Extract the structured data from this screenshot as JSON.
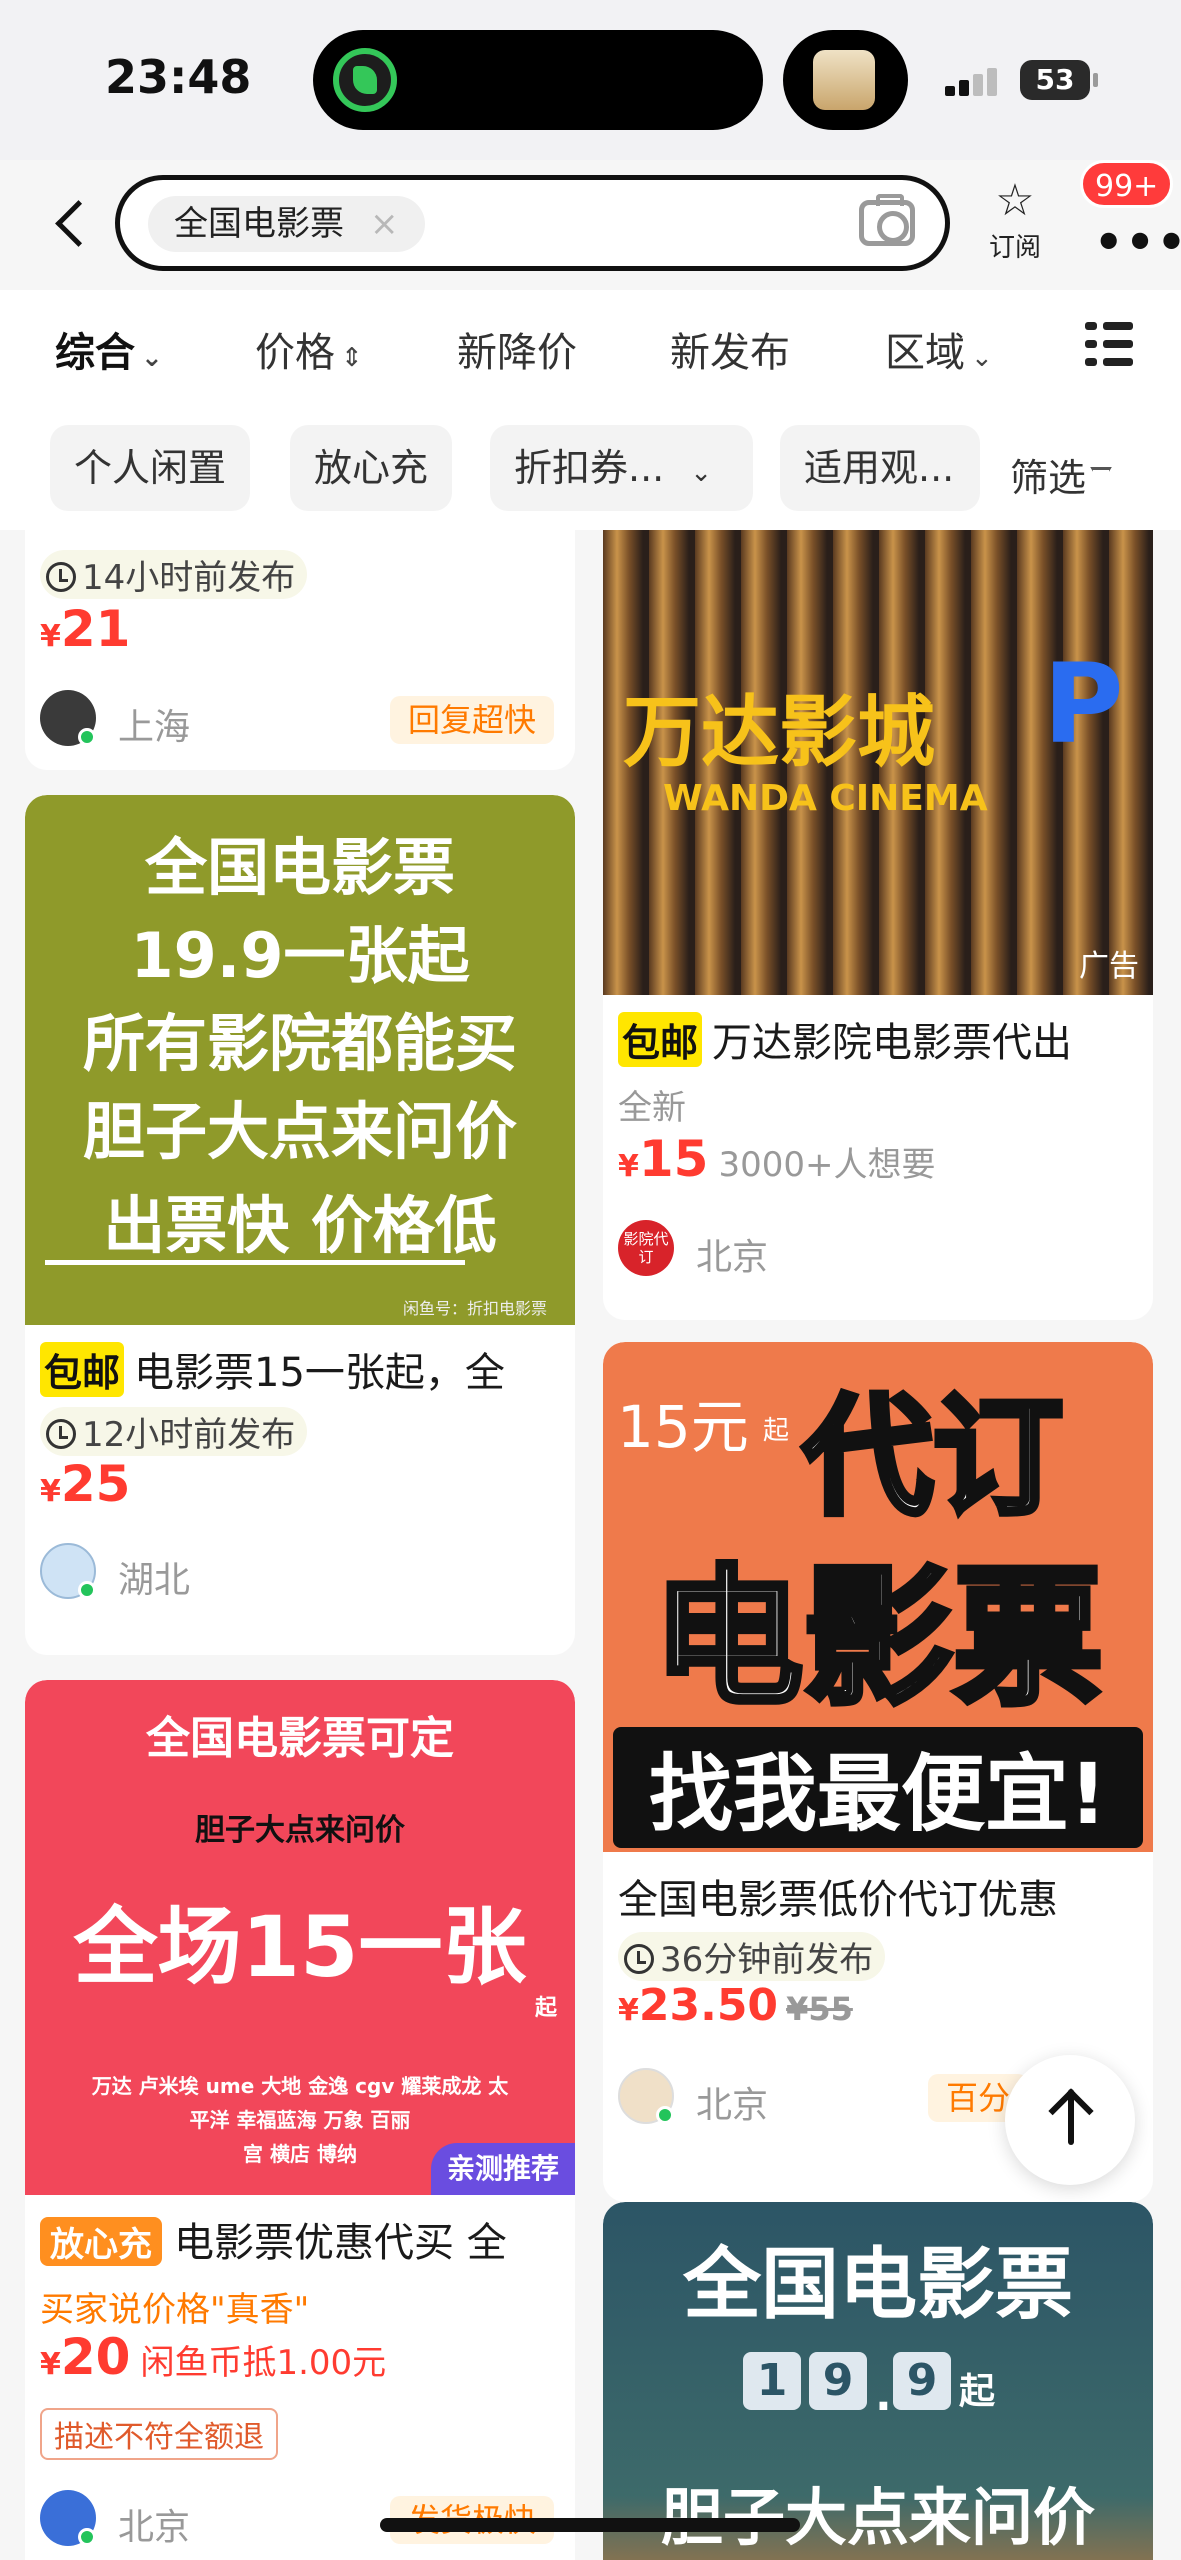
{
  "status": {
    "time": "23:48",
    "battery": "53"
  },
  "search": {
    "query": "全国电影票",
    "clear": "×"
  },
  "header": {
    "subscribe_label": "订阅",
    "badge": "99+",
    "more": "•••"
  },
  "sort_tabs": [
    {
      "label": "综合",
      "caret": "⌄"
    },
    {
      "label": "价格",
      "caret": "⇕"
    },
    {
      "label": "新降价"
    },
    {
      "label": "新发布"
    },
    {
      "label": "区域",
      "caret": "⌄"
    }
  ],
  "filters": [
    "个人闲置",
    "放心充",
    "折扣券...",
    "适用观...",
    "筛选"
  ],
  "left_column": {
    "card0": {
      "time": "14小时前发布",
      "price": "21",
      "location": "上海",
      "tag": "回复超快"
    },
    "card1": {
      "poster": [
        "全国电影票",
        "19.9一张起",
        "所有影院都能买",
        "胆子大点来问价",
        "出票快 价格低"
      ],
      "watermark": "闲鱼号：折扣电影票",
      "tag": "包邮",
      "title": "电影票15一张起，全",
      "time": "12小时前发布",
      "price": "25",
      "location": "湖北"
    },
    "card2": {
      "poster": [
        "全国电影票可定",
        "胆子大点来问价",
        "全场15一张",
        "起",
        "万达 卢米埃 ume 大地 金逸 cgv 耀莱成龙 太",
        "平洋 幸福蓝海 万象 百丽",
        "宫 横店 博纳"
      ],
      "badge": "亲测推荐",
      "tag": "放心充",
      "title": "电影票优惠代买 全",
      "highlight": "买家说价格\"真香\"",
      "price": "20",
      "price_sub": "闲鱼币抵1.00元",
      "outline_tag": "描述不符全额退",
      "location": "北京",
      "tag2": "发货极快"
    }
  },
  "right_column": {
    "card0": {
      "poster_main": "万达影城",
      "poster_sub": "WANDA CINEMA",
      "ad": "广告",
      "tag": "包邮",
      "title": "万达影院电影票代出",
      "condition": "全新",
      "price": "15",
      "price_sub": "3000+人想要",
      "avatar_text": "影院代订",
      "location": "北京"
    },
    "card1": {
      "poster": [
        "15元",
        "起",
        "代订",
        "电影票",
        "找我最便宜!"
      ],
      "title": "全国电影票低价代订优惠",
      "time": "36分钟前发布",
      "price": "23.50",
      "orig_price": "¥55",
      "location": "北京",
      "tag": "百分"
    },
    "card2": {
      "poster": [
        "全国电影票",
        "1",
        "9",
        ".",
        "9",
        "起",
        "胆子大点来问价"
      ]
    }
  },
  "colors": {
    "price": "#ff3b30",
    "accent_yellow": "#ffe600",
    "olive_poster": "#8f9a2a",
    "red_poster": "#f2475a",
    "orange_poster": "#ef7a4b",
    "teal_poster": "#2c5566"
  }
}
